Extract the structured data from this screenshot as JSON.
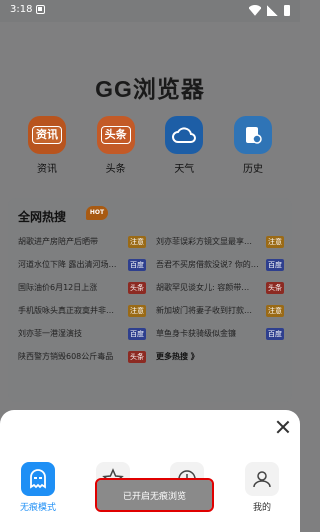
{
  "status_bar": {
    "time": "3:18"
  },
  "app": {
    "title": "GG浏览器"
  },
  "shortcuts": [
    {
      "label": "资讯",
      "icon": "news-icon",
      "badge": "资讯"
    },
    {
      "label": "头条",
      "icon": "headlines-icon",
      "badge": "头条"
    },
    {
      "label": "天气",
      "icon": "weather-icon",
      "badge": ""
    },
    {
      "label": "历史",
      "icon": "history-icon",
      "badge": ""
    }
  ],
  "hot_search": {
    "title": "全网热搜",
    "badge": "HOT",
    "items": [
      {
        "text": "胡歌进产房陪产后晒带",
        "tag": "注意",
        "tag_color": "orange"
      },
      {
        "text": "刘亦菲误彩方镜文显最享…",
        "tag": "注意",
        "tag_color": "orange"
      },
      {
        "text": "河道水位下降 露出清河场…",
        "tag": "百度",
        "tag_color": "blue"
      },
      {
        "text": "吾君不买房借款没说? 你的…",
        "tag": "百度",
        "tag_color": "blue"
      },
      {
        "text": "国际油价6月12日上涨",
        "tag": "头条",
        "tag_color": "red"
      },
      {
        "text": "胡歌罕见谈女儿: 容颜带…",
        "tag": "头条",
        "tag_color": "red"
      },
      {
        "text": "手机版咏头真正寂寞并非…",
        "tag": "注意",
        "tag_color": "orange"
      },
      {
        "text": "新加坡门将妻子收到打款…",
        "tag": "注意",
        "tag_color": "orange"
      },
      {
        "text": "刘亦菲一港湿演技",
        "tag": "百度",
        "tag_color": "blue"
      },
      {
        "text": "草鱼身卡获骑级似金镰",
        "tag": "百度",
        "tag_color": "blue"
      },
      {
        "text": "陕西警方销毁608公斤毒品",
        "tag": "头条",
        "tag_color": "red"
      },
      {
        "text": "更多热搜 》",
        "tag": "",
        "tag_color": ""
      }
    ]
  },
  "sheet": {
    "options": [
      {
        "label": "无痕模式",
        "icon": "incognito-icon",
        "active": true
      },
      {
        "label": "收藏",
        "icon": "star-icon",
        "active": false
      },
      {
        "label": "历史",
        "icon": "clock-icon",
        "active": false
      },
      {
        "label": "我的",
        "icon": "user-icon",
        "active": false
      }
    ],
    "toast": "已开启无痕浏览"
  },
  "colors": {
    "accent": "#1e8ff5",
    "highlight_border": "#e00000"
  }
}
